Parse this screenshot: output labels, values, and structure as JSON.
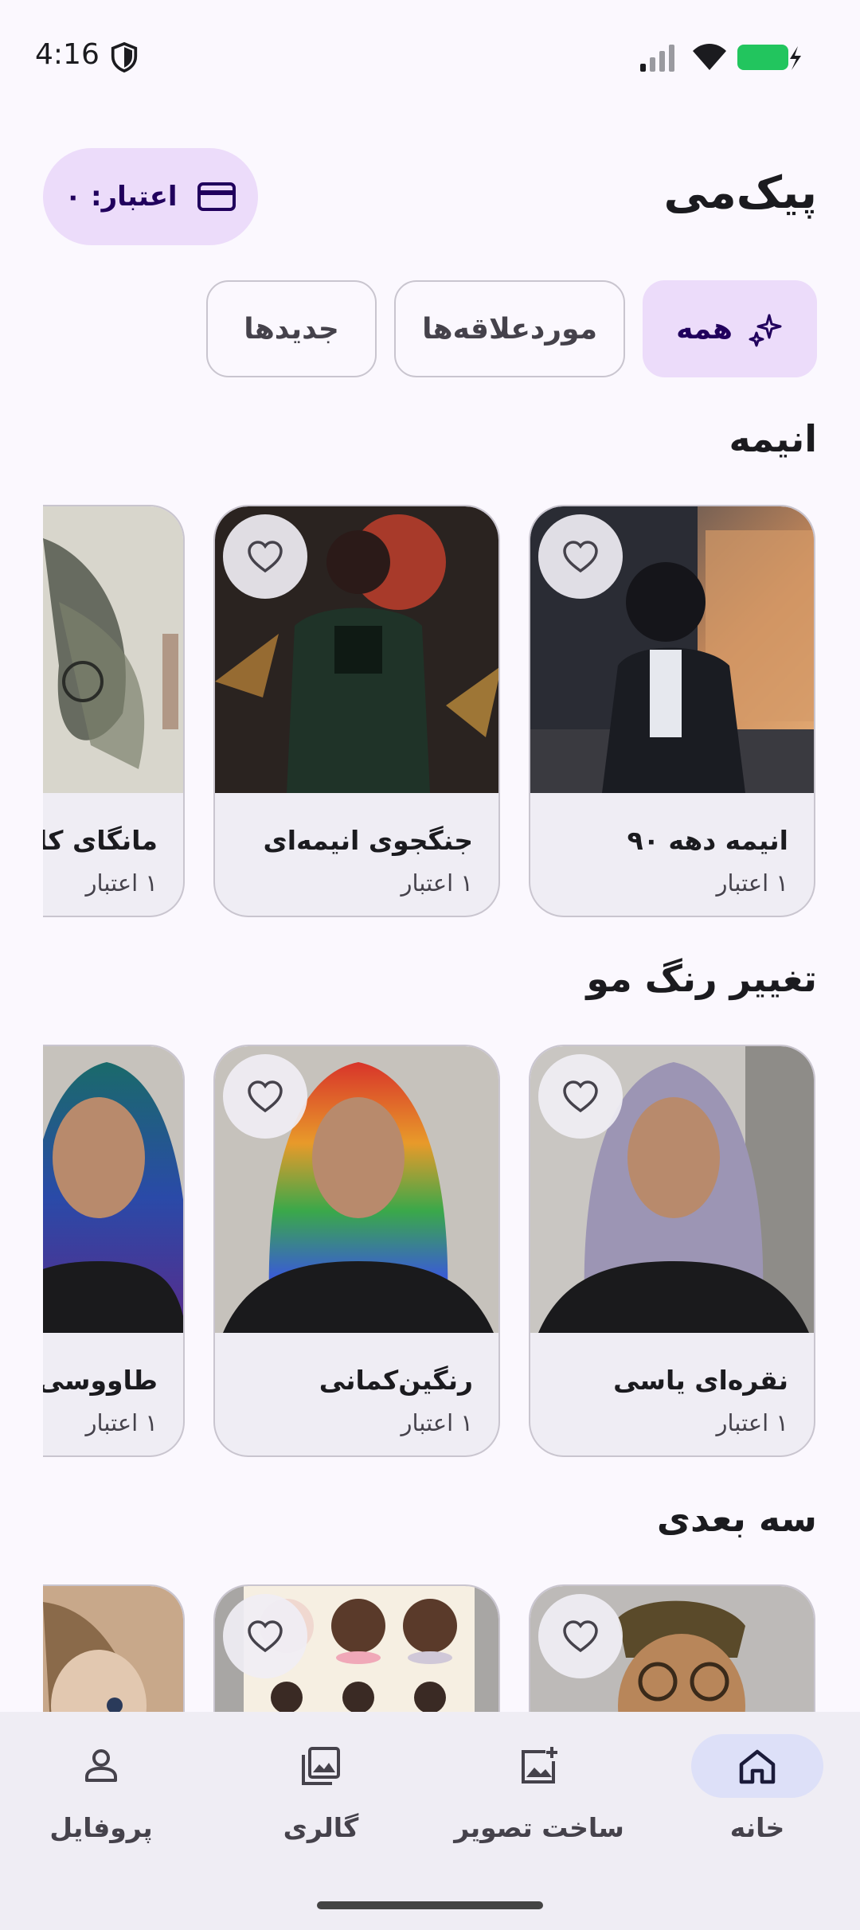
{
  "status": {
    "time": "4:16",
    "icons": [
      "shield-icon",
      "signal-icon",
      "wifi-icon",
      "battery-charging-icon"
    ],
    "battery_color": "#22c55e"
  },
  "header": {
    "app_title": "پیک‌می",
    "credit_label": "اعتبار: ۰",
    "credit_icon": "credit-card-icon"
  },
  "filters": [
    {
      "label": "همه",
      "active": true,
      "icon": "sparkles-icon"
    },
    {
      "label": "موردعلاقه‌ها",
      "active": false
    },
    {
      "label": "جدیدها",
      "active": false
    }
  ],
  "sections": [
    {
      "title": "انیمه",
      "cards": [
        {
          "title": "انیمه دهه ۹۰",
          "credit": "۱ اعتبار"
        },
        {
          "title": "جنگجوی انیمه‌ای",
          "credit": "۱ اعتبار"
        },
        {
          "title": "مانگای کلاژ",
          "credit": "۱ اعتبار"
        }
      ]
    },
    {
      "title": "تغییر رنگ مو",
      "cards": [
        {
          "title": "نقره‌ای یاسی",
          "credit": "۱ اعتبار"
        },
        {
          "title": "رنگین‌کمانی",
          "credit": "۱ اعتبار"
        },
        {
          "title": "طاووسی",
          "credit": "۱ اعتبار"
        }
      ]
    },
    {
      "title": "سه بعدی",
      "cards": [
        {},
        {},
        {}
      ]
    }
  ],
  "nav": {
    "items": [
      {
        "label": "خانه",
        "icon": "home-icon",
        "active": true
      },
      {
        "label": "ساخت تصویر",
        "icon": "add-image-icon",
        "active": false
      },
      {
        "label": "گالری",
        "icon": "gallery-icon",
        "active": false
      },
      {
        "label": "پروفایل",
        "icon": "person-icon",
        "active": false
      }
    ]
  },
  "colors": {
    "accent_container": "#ecdcfa",
    "on_accent": "#21005d",
    "background": "#fbf8fe",
    "nav_active": "#dde0f8"
  }
}
